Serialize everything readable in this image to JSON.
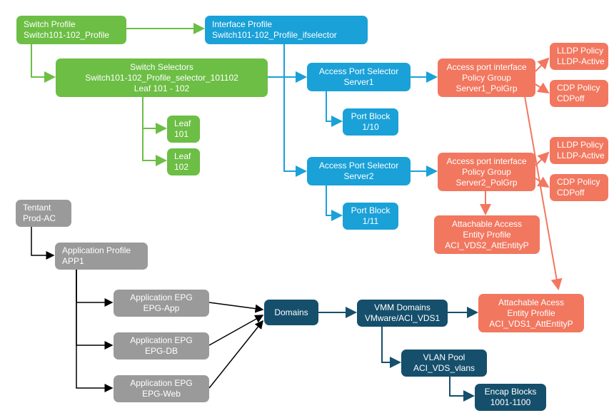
{
  "colors": {
    "green": "#6cbe45",
    "blue": "#1aa1d8",
    "orange": "#f2775f",
    "grey": "#9a9a9a",
    "navy": "#154f6b"
  },
  "nodes": {
    "switch_profile": {
      "l1": "Switch Profile",
      "l2": "Switch101-102_Profile"
    },
    "switch_selectors": {
      "l1": "Switch Selectors",
      "l2": "Switch101-102_Profile_selector_101102",
      "l3": "Leaf 101 - 102"
    },
    "leaf101": {
      "l1": "Leaf",
      "l2": "101"
    },
    "leaf102": {
      "l1": "Leaf",
      "l2": "102"
    },
    "if_profile": {
      "l1": "Interface Profile",
      "l2": "Switch101-102_Profile_ifselector"
    },
    "aps1": {
      "l1": "Access Port Selector",
      "l2": "Server1"
    },
    "pb1": {
      "l1": "Port Block",
      "l2": "1/10"
    },
    "aps2": {
      "l1": "Access Port Selector",
      "l2": "Server2"
    },
    "pb2": {
      "l1": "Port Block",
      "l2": "1/11"
    },
    "pg1": {
      "l1": "Access port interface",
      "l2": "Policy Group",
      "l3": "Server1_PolGrp"
    },
    "pg2": {
      "l1": "Access port interface",
      "l2": "Policy Group",
      "l3": "Server2_PolGrp"
    },
    "lldp1": {
      "l1": "LLDP Policy",
      "l2": "LLDP-Active"
    },
    "cdp1": {
      "l1": "CDP Policy",
      "l2": "CDPoff"
    },
    "lldp2": {
      "l1": "LLDP Policy",
      "l2": "LLDP-Active"
    },
    "cdp2": {
      "l1": "CDP Policy",
      "l2": "CDPoff"
    },
    "aep2": {
      "l1": "Attachable Access",
      "l2": "Entity Profile",
      "l3": "ACI_VDS2_AttEntityP"
    },
    "aep1": {
      "l1": "Attachable Acess",
      "l2": "Entity Profile",
      "l3": "ACI_VDS1_AttEntityP"
    },
    "tenant": {
      "l1": "Tentant",
      "l2": "Prod-AC"
    },
    "app1": {
      "l1": "Application Profile",
      "l2": "APP1"
    },
    "epg_app": {
      "l1": "Application EPG",
      "l2": "EPG-App"
    },
    "epg_db": {
      "l1": "Application EPG",
      "l2": "EPG-DB"
    },
    "epg_web": {
      "l1": "Application EPG",
      "l2": "EPG-Web"
    },
    "domains": {
      "l1": "Domains"
    },
    "vmm": {
      "l1": "VMM Domains",
      "l2": "VMware/ACI_VDS1"
    },
    "vlan_pool": {
      "l1": "VLAN Pool",
      "l2": "ACI_VDS_vlans"
    },
    "encap": {
      "l1": "Encap Blocks",
      "l2": "1001-1100"
    }
  },
  "chart_data": {
    "type": "table",
    "title": "ACI fabric access / tenant policy relationship diagram",
    "nodes": [
      {
        "id": "switch_profile",
        "group": "fabric_access",
        "label": "Switch Profile\nSwitch101-102_Profile"
      },
      {
        "id": "switch_selectors",
        "group": "fabric_access",
        "label": "Switch Selectors\nSwitch101-102_Profile_selector_101102\nLeaf 101 - 102"
      },
      {
        "id": "leaf101",
        "group": "fabric_access",
        "label": "Leaf 101"
      },
      {
        "id": "leaf102",
        "group": "fabric_access",
        "label": "Leaf 102"
      },
      {
        "id": "if_profile",
        "group": "interface",
        "label": "Interface Profile\nSwitch101-102_Profile_ifselector"
      },
      {
        "id": "aps1",
        "group": "interface",
        "label": "Access Port Selector\nServer1"
      },
      {
        "id": "pb1",
        "group": "interface",
        "label": "Port Block 1/10"
      },
      {
        "id": "aps2",
        "group": "interface",
        "label": "Access Port Selector\nServer2"
      },
      {
        "id": "pb2",
        "group": "interface",
        "label": "Port Block 1/11"
      },
      {
        "id": "pg1",
        "group": "policy",
        "label": "Access port interface Policy Group\nServer1_PolGrp"
      },
      {
        "id": "pg2",
        "group": "policy",
        "label": "Access port interface Policy Group\nServer2_PolGrp"
      },
      {
        "id": "lldp1",
        "group": "policy",
        "label": "LLDP Policy\nLLDP-Active"
      },
      {
        "id": "cdp1",
        "group": "policy",
        "label": "CDP Policy\nCDPoff"
      },
      {
        "id": "lldp2",
        "group": "policy",
        "label": "LLDP Policy\nLLDP-Active"
      },
      {
        "id": "cdp2",
        "group": "policy",
        "label": "CDP Policy\nCDPoff"
      },
      {
        "id": "aep2",
        "group": "policy",
        "label": "Attachable Access Entity Profile\nACI_VDS2_AttEntityP"
      },
      {
        "id": "aep1",
        "group": "policy",
        "label": "Attachable Access Entity Profile\nACI_VDS1_AttEntityP"
      },
      {
        "id": "tenant",
        "group": "tenant",
        "label": "Tenant\nProd-AC"
      },
      {
        "id": "app1",
        "group": "tenant",
        "label": "Application Profile\nAPP1"
      },
      {
        "id": "epg_app",
        "group": "tenant",
        "label": "Application EPG\nEPG-App"
      },
      {
        "id": "epg_db",
        "group": "tenant",
        "label": "Application EPG\nEPG-DB"
      },
      {
        "id": "epg_web",
        "group": "tenant",
        "label": "Application EPG\nEPG-Web"
      },
      {
        "id": "domains",
        "group": "domain",
        "label": "Domains"
      },
      {
        "id": "vmm",
        "group": "domain",
        "label": "VMM Domains\nVMware/ACI_VDS1"
      },
      {
        "id": "vlan_pool",
        "group": "domain",
        "label": "VLAN Pool\nACI_VDS_vlans"
      },
      {
        "id": "encap",
        "group": "domain",
        "label": "Encap Blocks\n1001-1100"
      }
    ],
    "edges": [
      [
        "switch_profile",
        "if_profile"
      ],
      [
        "switch_profile",
        "switch_selectors"
      ],
      [
        "switch_selectors",
        "if_profile"
      ],
      [
        "switch_selectors",
        "leaf101"
      ],
      [
        "switch_selectors",
        "leaf102"
      ],
      [
        "if_profile",
        "aps1"
      ],
      [
        "if_profile",
        "aps2"
      ],
      [
        "aps1",
        "pb1"
      ],
      [
        "aps1",
        "pg1"
      ],
      [
        "aps2",
        "pb2"
      ],
      [
        "aps2",
        "pg2"
      ],
      [
        "pg1",
        "lldp1"
      ],
      [
        "pg1",
        "cdp1"
      ],
      [
        "pg1",
        "aep1"
      ],
      [
        "pg2",
        "lldp2"
      ],
      [
        "pg2",
        "cdp2"
      ],
      [
        "pg2",
        "aep2"
      ],
      [
        "tenant",
        "app1"
      ],
      [
        "app1",
        "epg_app"
      ],
      [
        "app1",
        "epg_db"
      ],
      [
        "app1",
        "epg_web"
      ],
      [
        "epg_app",
        "domains"
      ],
      [
        "epg_db",
        "domains"
      ],
      [
        "epg_web",
        "domains"
      ],
      [
        "domains",
        "vmm"
      ],
      [
        "vmm",
        "aep1"
      ],
      [
        "vmm",
        "vlan_pool"
      ],
      [
        "vlan_pool",
        "encap"
      ]
    ],
    "group_colors": {
      "fabric_access": "#6cbe45",
      "interface": "#1aa1d8",
      "policy": "#f2775f",
      "tenant": "#9a9a9a",
      "domain": "#154f6b"
    }
  }
}
